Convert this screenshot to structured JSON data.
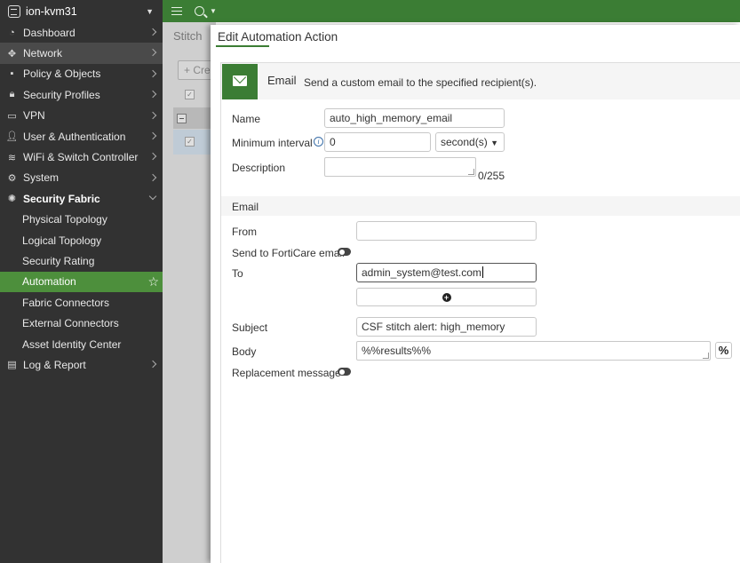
{
  "device": {
    "name": "ion-kvm31"
  },
  "sidebar": {
    "items": [
      {
        "label": "Dashboard",
        "icon": "dashboard-icon",
        "glyph": "◔"
      },
      {
        "label": "Network",
        "icon": "network-icon",
        "glyph": "✥"
      },
      {
        "label": "Policy & Objects",
        "icon": "policy-icon",
        "glyph": "▪"
      },
      {
        "label": "Security Profiles",
        "icon": "lock-icon",
        "glyph": "🔒︎"
      },
      {
        "label": "VPN",
        "icon": "laptop-icon",
        "glyph": "▭"
      },
      {
        "label": "User & Authentication",
        "icon": "user-icon",
        "glyph": "👤︎"
      },
      {
        "label": "WiFi & Switch Controller",
        "icon": "wifi-icon",
        "glyph": "≋"
      },
      {
        "label": "System",
        "icon": "gear-icon",
        "glyph": "⚙"
      },
      {
        "label": "Security Fabric",
        "icon": "fabric-icon",
        "glyph": "✺"
      }
    ],
    "sub_items": [
      "Physical Topology",
      "Logical Topology",
      "Security Rating",
      "Automation",
      "Fabric Connectors",
      "External Connectors",
      "Asset Identity Center"
    ],
    "last_item": {
      "label": "Log & Report",
      "icon": "chart-icon",
      "glyph": "▤"
    },
    "selected_sub": "Automation"
  },
  "background": {
    "title": "Stitch",
    "create_label": "Cre"
  },
  "panel": {
    "title": "Edit Automation Action",
    "action_name": "Email",
    "action_desc": "Send a custom email to the specified recipient(s).",
    "form": {
      "name_label": "Name",
      "name_value": "auto_high_memory_email",
      "interval_label": "Minimum interval",
      "interval_value": "0",
      "interval_unit": "second(s)",
      "description_label": "Description",
      "description_value": "",
      "description_counter": "0/255",
      "section_email": "Email",
      "from_label": "From",
      "from_value": "",
      "forticare_label": "Send to FortiCare email",
      "to_label": "To",
      "to_value": "admin_system@test.com",
      "subject_label": "Subject",
      "subject_value": "CSF stitch alert: high_memory",
      "body_label": "Body",
      "body_value": "%%results%%",
      "replacement_label": "Replacement message"
    }
  },
  "colors": {
    "accent": "#3b7d34",
    "sidebar_bg": "#323232",
    "selected": "#4d8f3c"
  }
}
